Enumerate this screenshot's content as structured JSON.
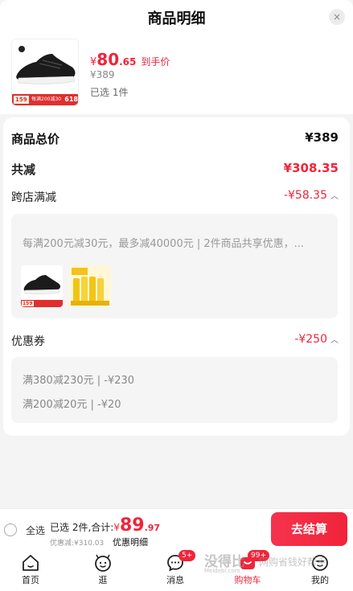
{
  "header": {
    "title": "商品明细",
    "close_icon": "×"
  },
  "product": {
    "price_symbol": "¥",
    "price_int": "80",
    "price_dec": ".65",
    "price_label": "到手价",
    "original_price": "¥389",
    "selected_count": "已选 1件",
    "thumb_badge_price": "159",
    "thumb_badge_promo": "每满200减30",
    "thumb_badge_618": "618"
  },
  "summary": {
    "total_label": "商品总价",
    "total_value": "¥389",
    "reduce_label": "共减",
    "reduce_value": "¥308.35",
    "cross_store_label": "跨店满减",
    "cross_store_value": "-¥58.35",
    "cross_store_rule": "每满200元减30元，最多减40000元 | 2件商品共享优惠，...",
    "mini_badge_price": "159",
    "coupon_label": "优惠券",
    "coupon_value": "-¥250",
    "coupons": [
      "满380减230元 | -¥230",
      "满200减20元 | -¥20"
    ]
  },
  "bottom_bar": {
    "select_all_label": "全选",
    "selected_summary": "已选 2件,合计:",
    "total_symbol": "¥",
    "total_int": "89",
    "total_dec": ".97",
    "discount_text": "优惠减:¥310.03",
    "detail_link": "优惠明细",
    "checkout_label": "去结算"
  },
  "tabs": [
    {
      "label": "首页",
      "icon": "home-icon"
    },
    {
      "label": "逛",
      "icon": "face-icon"
    },
    {
      "label": "消息",
      "icon": "message-icon",
      "badge": "5+"
    },
    {
      "label": "购物车",
      "icon": "cart-icon",
      "badge": "99+",
      "active": true
    },
    {
      "label": "我的",
      "icon": "profile-icon"
    }
  ],
  "watermark": {
    "main": "没得比",
    "sub": "Meidebi.com",
    "right": "网购省钱好帮手"
  },
  "colors": {
    "accent": "#f0243a",
    "background": "#f4f4f4",
    "card": "#ffffff"
  }
}
